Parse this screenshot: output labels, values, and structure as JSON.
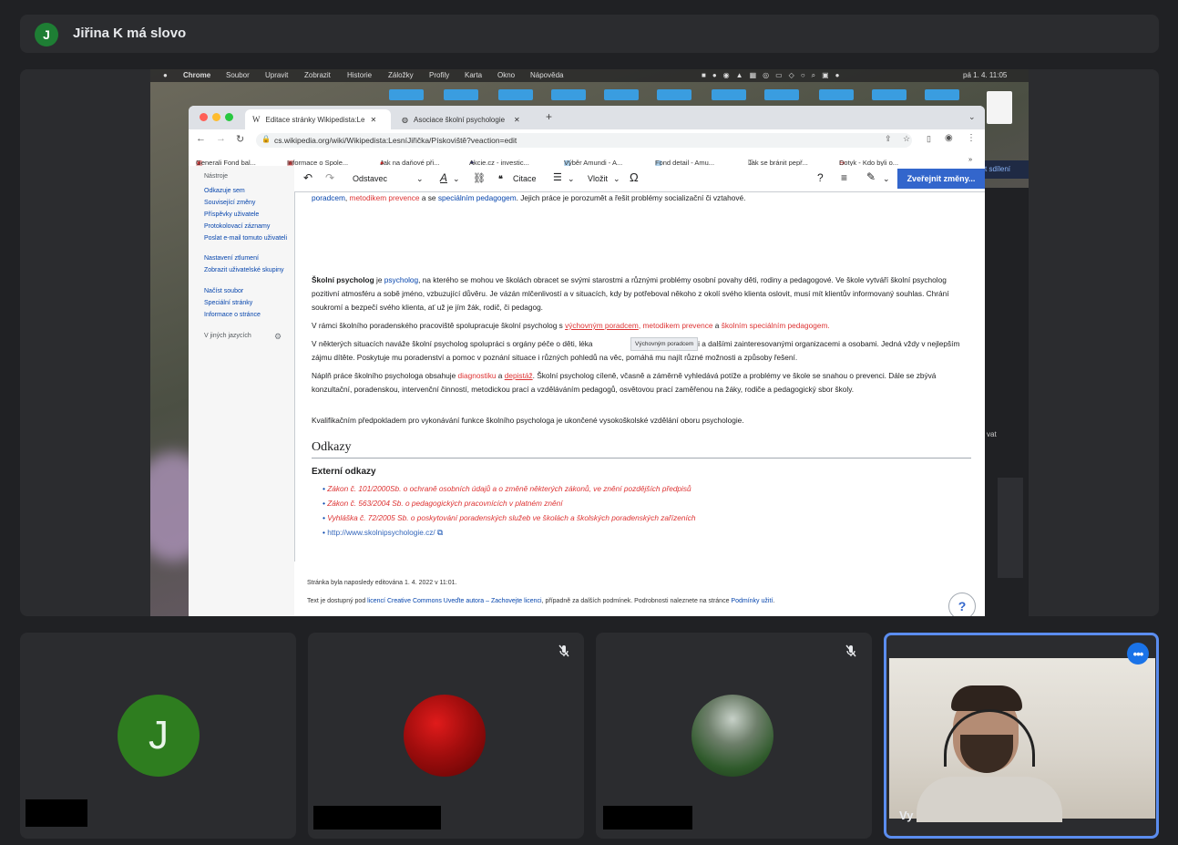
{
  "speaker_bar": {
    "avatar_initial": "J",
    "text": "Jiřina K má slovo"
  },
  "menubar": {
    "items": [
      "Chrome",
      "Soubor",
      "Upravit",
      "Zobrazit",
      "Historie",
      "Záložky",
      "Profily",
      "Karta",
      "Okno",
      "Nápověda"
    ],
    "clock": "pá 1. 4.  11:05"
  },
  "browser": {
    "tabs": [
      {
        "label": "Editace stránky Wikipedista:Le"
      },
      {
        "label": "Asociace školní psychologie"
      }
    ],
    "url": "cs.wikipedia.org/wiki/Wikipedista:LesníJiřička/Pískoviště?veaction=edit",
    "bookmarks": [
      "Generali Fond bal...",
      "Informace o Spole...",
      "Jak na daňové při...",
      "Akcie.cz - investic...",
      "Výběr Amundi - A...",
      "Fond detail - Amu...",
      "Jak se bránit pepř...",
      "Dotyk - Kdo byli o..."
    ]
  },
  "wiki": {
    "sidebar_heading": "Nástroje",
    "sidebar": [
      "Odkazuje sem",
      "Související změny",
      "Příspěvky uživatele",
      "Protokolovací záznamy",
      "Poslat e-mail tomuto uživateli",
      "Nastavení ztlumení",
      "Zobrazit uživatelské skupiny",
      "Načíst soubor",
      "Speciální stránky",
      "Informace o stránce"
    ],
    "languages": "V jiných jazycích",
    "toolbar": {
      "style": "Odstavec",
      "cite": "Citace",
      "insert": "Vložit",
      "publish": "Zveřejnit změny..."
    },
    "top_line": {
      "a": "poradcem",
      "b": "metodikem prevence",
      "c": " a se ",
      "d": "speciálním pedagogem",
      "e": ". Jejich práce je porozumět a řešit problémy socializační či vztahové."
    },
    "p1": {
      "bold": "Školní psycholog",
      "pre": " je ",
      "link": "psycholog",
      "rest": ", na kterého se mohou ve školách obracet se svými starostmi a různými problémy osobní povahy děti, rodiny a pedagogové. Ve škole vytváří školní psycholog pozitivní atmosféru a sobě jméno, vzbuzující důvěru. Je vázán mlčenlivostí a v situacích, kdy by potřeboval někoho z okolí svého klienta oslovit, musí mít klientův informovaný souhlas. Chrání soukromí a bezpečí svého klienta, ať už je jím žák, rodič, či pedagog."
    },
    "p2": {
      "pre": "V rámci školního poradenského pracoviště spolupracuje školní psycholog s ",
      "l1": "výchovným poradcem",
      "s1": ", ",
      "l2": "metodikem prevence",
      "s2": " a ",
      "l3": "školním speciálním pedagogem",
      "s3": "."
    },
    "tooltip": "Výchovným poradcem",
    "p3": {
      "a": "V některých situacích naváže školní psycholog spolupráci s orgány péče o děti, léka",
      "b": "če o děti a dalšími zainteresovanými organizacemi a osobami. Jedná vždy v nejlepším zájmu dítěte. Poskytuje mu poradenství a pomoc v poznání situace i různých pohledů na věc, pomáhá mu najít různé možnosti a způsoby řešení."
    },
    "p4": {
      "pre": "Náplň práce školního psychologa obsahuje ",
      "l1": "diagnostiku",
      "s1": " a ",
      "l2": "depistáž",
      "rest": ". Školní psycholog cíleně, včasně a záměrně vyhledává potíže a problémy ve škole se snahou o prevenci. Dále se zbývá konzultační, poradenskou, intervenční činností, metodickou prací a vzděláváním pedagogů, osvětovou prací zaměřenou na žáky, rodiče a pedagogický sbor školy."
    },
    "p5": "Kvalifikačním předpokladem pro vykonávání funkce školního psychologa je ukončené vysokoškolské vzdělání oboru psychologie.",
    "h2": "Odkazy",
    "h3": "Externí odkazy",
    "links": [
      "Zákon č. 101/2000Sb. o ochraně osobních údajů a o změně některých zákonů, ve znění pozdějších předpisů",
      "Zákon č. 563/2004 Sb. o pedagogických pracovnících v platném znění",
      "Vyhláška č. 72/2005 Sb. o poskytování poradenských služeb ve školách a školských poradenských zařízeních",
      "http://www.skolnipsychologie.cz/"
    ],
    "footer1": "Stránka byla naposledy editována 1. 4. 2022 v 11:01.",
    "footer2": {
      "pre": "Text je dostupný pod ",
      "link": "licencí Creative Commons Uveďte autora – Zachovejte licenci",
      "mid": ", případně za dalších podmínek. Podrobnosti naleznete na stránce ",
      "link2": "Podmínky užití",
      "end": "."
    },
    "help": "?"
  },
  "side_fragments": {
    "share_text": "t sdílení",
    "vat": "vat"
  },
  "tiles": [
    {
      "avatar_initial": "J"
    },
    {},
    {},
    {
      "name": "Vy",
      "more": "•••"
    }
  ],
  "colors": {
    "accent": "#1a73e8",
    "avatar_green": "#1e7e34",
    "wiki_link": "#0645ad",
    "wiki_red": "#d33",
    "publish": "#3366cc"
  }
}
